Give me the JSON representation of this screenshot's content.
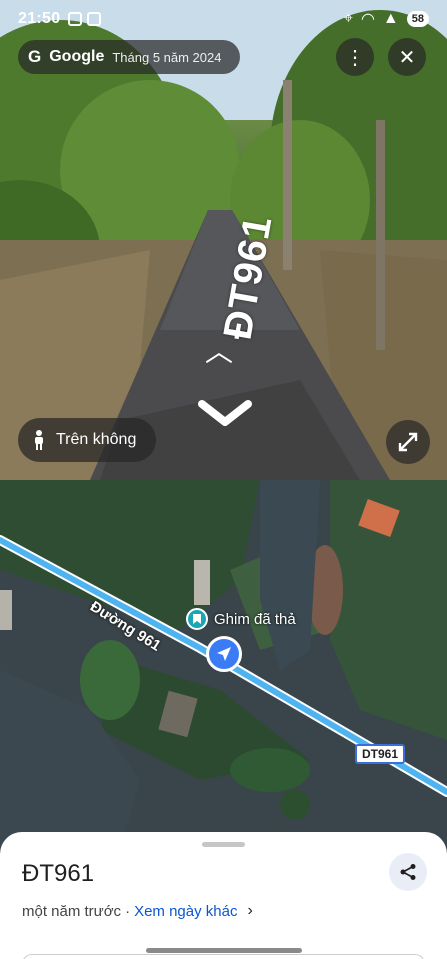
{
  "status_bar": {
    "time": "21:50",
    "battery": "58"
  },
  "streetview": {
    "brand": "Google",
    "date": "Tháng 5 năm 2024",
    "road_label": "ĐT961",
    "aerial_button": "Trên không",
    "icons": {
      "more": "more-vert-icon",
      "close": "close-icon",
      "person": "person-icon",
      "expand": "expand-icon"
    }
  },
  "map": {
    "route_label": "Đường 961",
    "pin_label": "Ghim đã thả",
    "shield_label": "DT961",
    "colors": {
      "route": "#4fb3f0",
      "pin": "#1aa6b7",
      "nav": "#3b7cf5"
    }
  },
  "sheet": {
    "title": "ĐT961",
    "time_ago": "một năm trước",
    "separator": "·",
    "other_dates_link": "Xem ngày khác"
  }
}
